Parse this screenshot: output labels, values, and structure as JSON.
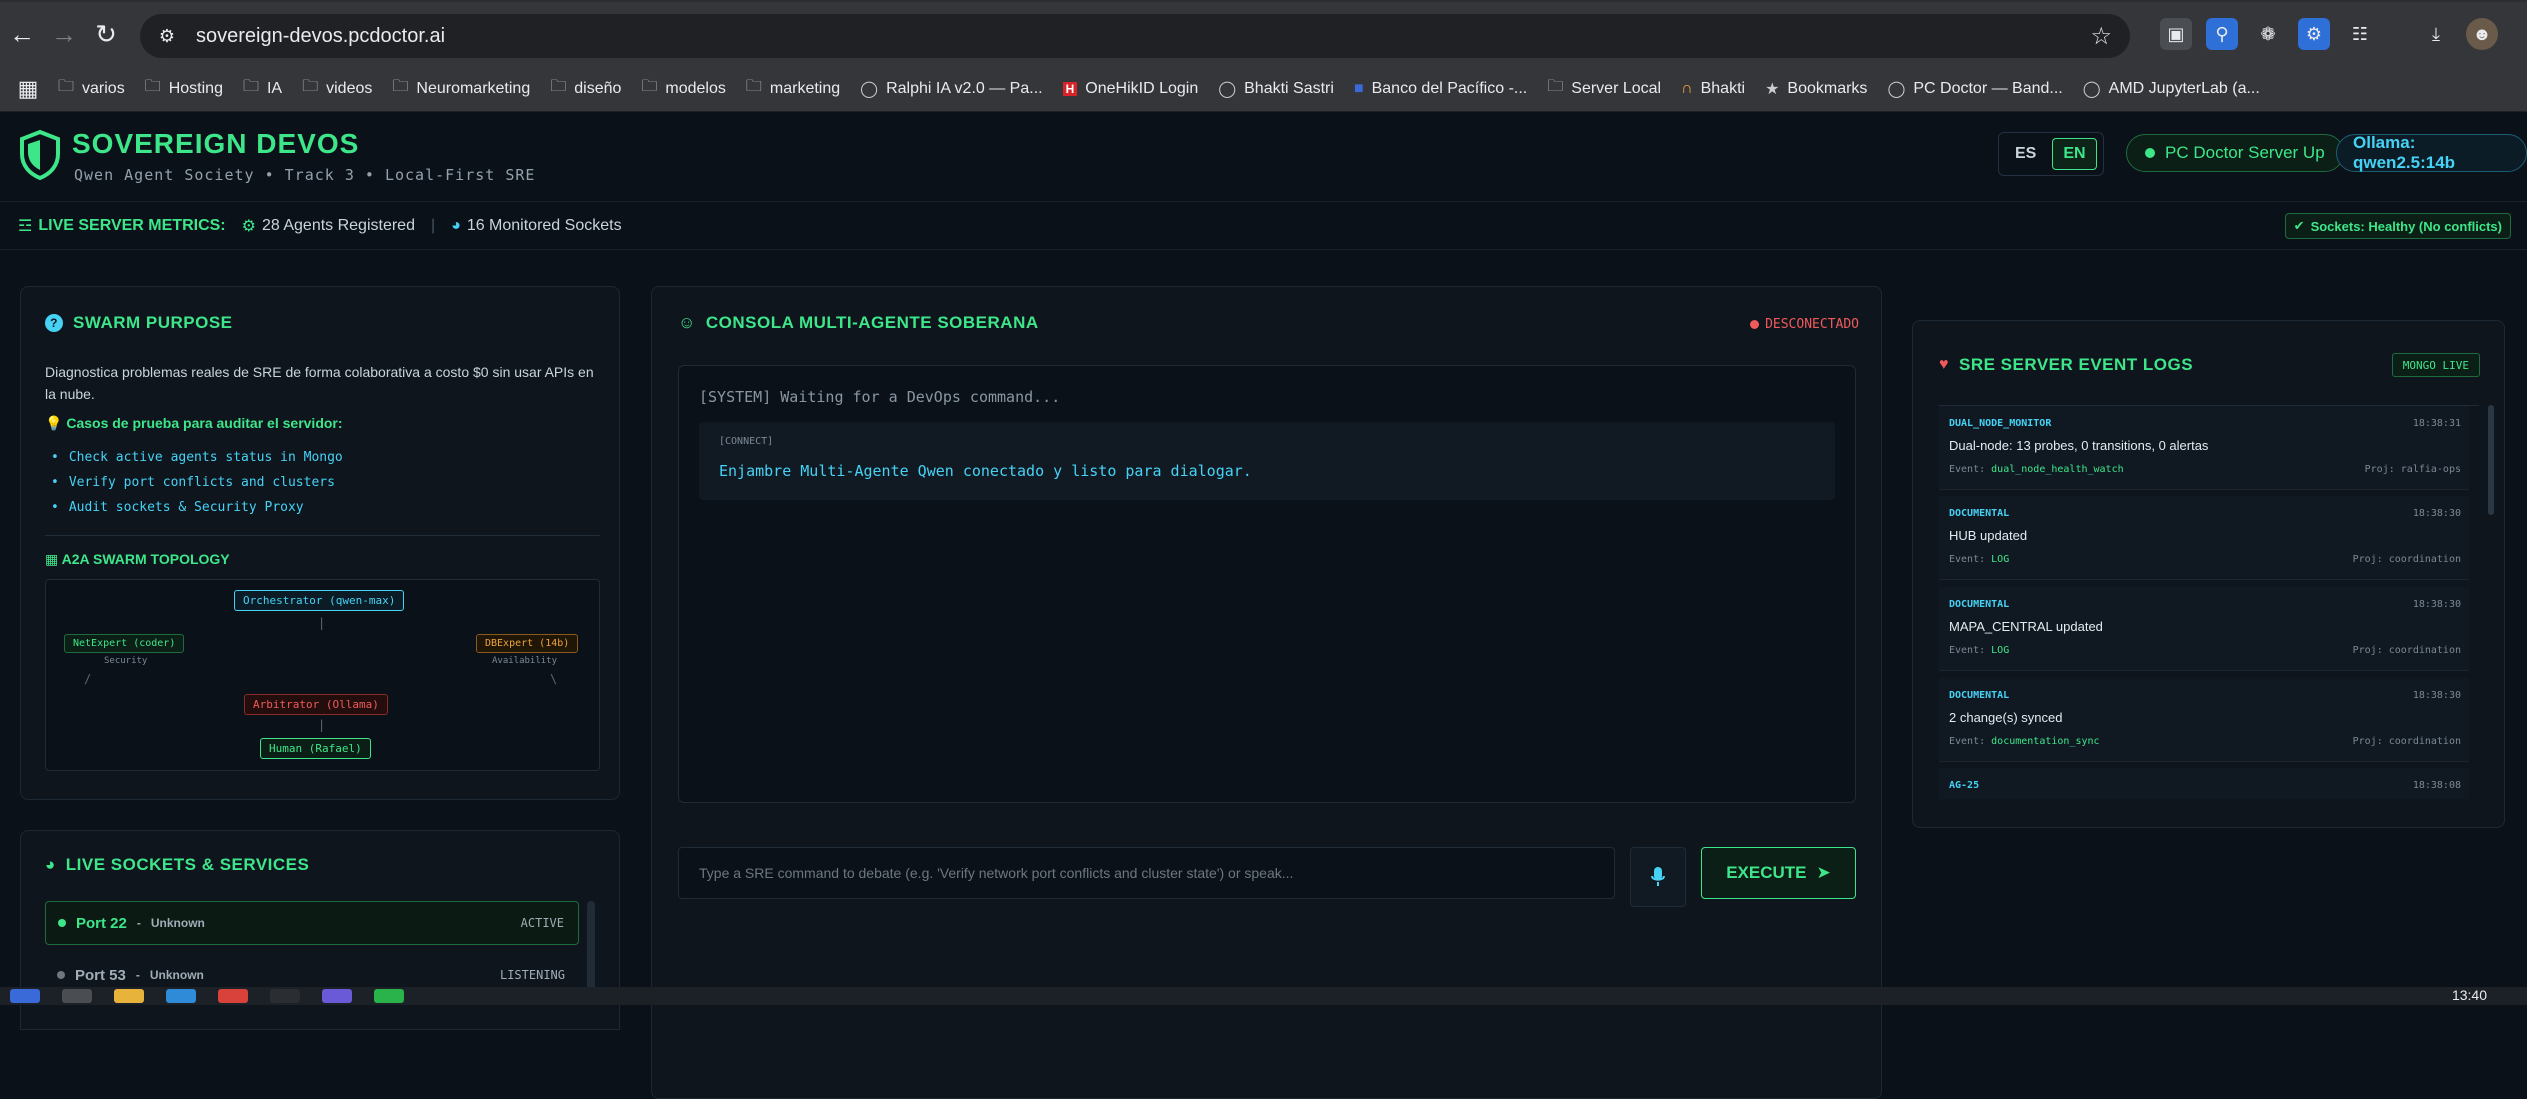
{
  "browser": {
    "url": "sovereign-devos.pcdoctor.ai",
    "bookmarks": [
      {
        "label": "varios",
        "icon": "folder-icon"
      },
      {
        "label": "Hosting",
        "icon": "folder-icon"
      },
      {
        "label": "IA",
        "icon": "folder-icon"
      },
      {
        "label": "videos",
        "icon": "folder-icon"
      },
      {
        "label": "Neuromarketing",
        "icon": "folder-icon"
      },
      {
        "label": "diseño",
        "icon": "folder-icon"
      },
      {
        "label": "modelos",
        "icon": "folder-icon"
      },
      {
        "label": "marketing",
        "icon": "folder-icon"
      },
      {
        "label": "Ralphi IA v2.0 — Pa...",
        "icon": "globe-icon"
      },
      {
        "label": "OneHikID Login",
        "icon": "hik-icon"
      },
      {
        "label": "Bhakti Sastri",
        "icon": "globe-icon"
      },
      {
        "label": "Banco del Pacífico -...",
        "icon": "bank-icon"
      },
      {
        "label": "Server Local",
        "icon": "folder-icon"
      },
      {
        "label": "Bhakti",
        "icon": "bhakti-icon"
      },
      {
        "label": "Bookmarks",
        "icon": "star-icon"
      },
      {
        "label": "PC Doctor — Band...",
        "icon": "globe-icon"
      },
      {
        "label": "AMD JupyterLab (a...",
        "icon": "globe-icon"
      }
    ]
  },
  "header": {
    "title": "SOVEREIGN DEVOS",
    "subtitle": "Qwen Agent Society • Track 3 • Local-First SRE",
    "lang_es": "ES",
    "lang_en": "EN",
    "server_status": "PC Doctor Server Up",
    "ollama": "Ollama: qwen2.5:14b"
  },
  "metrics": {
    "title": "LIVE SERVER METRICS:",
    "agents": "28 Agents Registered",
    "sockets": "16 Monitored Sockets",
    "health": "Sockets: Healthy (No conflicts)"
  },
  "purpose": {
    "title": "SWARM PURPOSE",
    "description": "Diagnostica problemas reales de SRE de forma colaborativa a costo $0 sin usar APIs en la nube.",
    "cases_title": "Casos de prueba para auditar el servidor:",
    "cases": [
      "Check active agents status in Mongo",
      "Verify port conflicts and clusters",
      "Audit sockets & Security Proxy"
    ],
    "topology_title": "A2A SWARM TOPOLOGY",
    "nodes": {
      "orchestrator": "Orchestrator (qwen-max)",
      "net": "NetExpert (coder)",
      "net_sub": "Security",
      "db": "DBExpert (14b)",
      "db_sub": "Availability",
      "arbitrator": "Arbitrator (Ollama)",
      "human": "Human (Rafael)"
    }
  },
  "sockets": {
    "title": "LIVE SOCKETS & SERVICES",
    "rows": [
      {
        "port": "Port 22",
        "sep": "-",
        "service": "Unknown",
        "state": "ACTIVE"
      },
      {
        "port": "Port 53",
        "sep": "-",
        "service": "Unknown",
        "state": "LISTENING"
      }
    ]
  },
  "console": {
    "title": "CONSOLA MULTI-AGENTE SOBERANA",
    "status": "DESCONECTADO",
    "system_line": "[SYSTEM] Waiting for a DevOps command...",
    "msg_tag": "[CONNECT]",
    "msg_text": "Enjambre Multi-Agente Qwen conectado y listo para dialogar.",
    "input_placeholder": "Type a SRE command to debate (e.g. 'Verify network port conflicts and cluster state') or speak...",
    "execute": "EXECUTE"
  },
  "logs": {
    "title": "SRE SERVER EVENT LOGS",
    "badge": "MONGO LIVE",
    "event_label": "Event:",
    "proj_label": "Proj:",
    "items": [
      {
        "category": "DUAL_NODE_MONITOR",
        "time": "18:38:31",
        "message": "Dual-node: 13 probes, 0 transitions, 0 alertas",
        "event": "dual_node_health_watch",
        "project": "ralfia-ops"
      },
      {
        "category": "DOCUMENTAL",
        "time": "18:38:30",
        "message": "HUB updated",
        "event": "LOG",
        "project": "coordination"
      },
      {
        "category": "DOCUMENTAL",
        "time": "18:38:30",
        "message": "MAPA_CENTRAL updated",
        "event": "LOG",
        "project": "coordination"
      },
      {
        "category": "DOCUMENTAL",
        "time": "18:38:30",
        "message": "2 change(s) synced",
        "event": "documentation_sync",
        "project": "coordination"
      },
      {
        "category": "AG-25",
        "time": "18:38:08",
        "message": "",
        "event": "",
        "project": ""
      }
    ]
  },
  "taskbar": {
    "clock": "13:40"
  },
  "colors": {
    "accent_green": "#3ee68a",
    "accent_cyan": "#46d2f5",
    "danger": "#f05a5a",
    "warning": "#f0a33a",
    "background": "#0b1118"
  }
}
